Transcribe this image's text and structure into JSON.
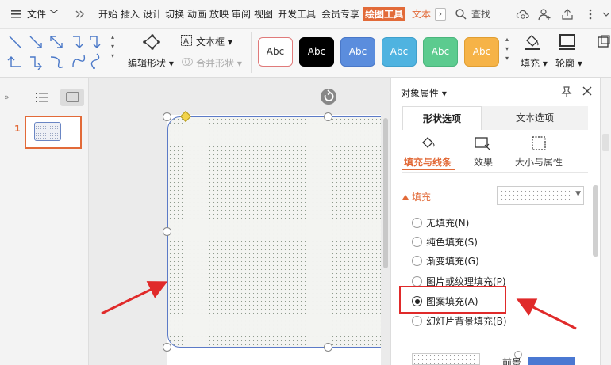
{
  "menubar": {
    "file_label": "文件",
    "tabs": [
      "开始",
      "插入",
      "设计",
      "切换",
      "动画",
      "放映",
      "审阅",
      "视图",
      "开发工具",
      "会员专享",
      "绘图工具",
      "文本"
    ],
    "active_tab": "绘图工具",
    "search_label": "查找"
  },
  "ribbon": {
    "edit_shape": "编辑形状",
    "text_box": "文本框",
    "merge_shape": "合并形状",
    "styles": [
      {
        "label": "Abc",
        "bg": "#ffffff",
        "fg": "#333333",
        "border": "#e07a7a"
      },
      {
        "label": "Abc",
        "bg": "#000000",
        "fg": "#ffffff",
        "border": "#000000"
      },
      {
        "label": "Abc",
        "bg": "#5b8ddd",
        "fg": "#ffffff",
        "border": "#4a78c8"
      },
      {
        "label": "Abc",
        "bg": "#4fb3e0",
        "fg": "#ffffff",
        "border": "#3fa0cc"
      },
      {
        "label": "Abc",
        "bg": "#5ccb8f",
        "fg": "#ffffff",
        "border": "#4ab57c"
      },
      {
        "label": "Abc",
        "bg": "#f6b347",
        "fg": "#ffffff",
        "border": "#e09e32"
      }
    ],
    "fill": "填充",
    "outline": "轮廓"
  },
  "slides_pane": {
    "slide_number": "1"
  },
  "properties": {
    "title": "对象属性",
    "tab_shape": "形状选项",
    "tab_text": "文本选项",
    "sub_fill_line": "填充与线条",
    "sub_effect": "效果",
    "sub_size": "大小与属性",
    "fill_header": "填充",
    "radio_options": [
      {
        "label": "无填充(N)",
        "checked": false
      },
      {
        "label": "纯色填充(S)",
        "checked": false
      },
      {
        "label": "渐变填充(G)",
        "checked": false
      },
      {
        "label": "图片或纹理填充(P)",
        "checked": false
      },
      {
        "label": "图案填充(A)",
        "checked": true
      },
      {
        "label": "幻灯片背景填充(B)",
        "checked": false
      }
    ],
    "bottom_label": "前景"
  },
  "colors": {
    "accent": "#e26a38",
    "annotation_red": "#e02a2a"
  }
}
